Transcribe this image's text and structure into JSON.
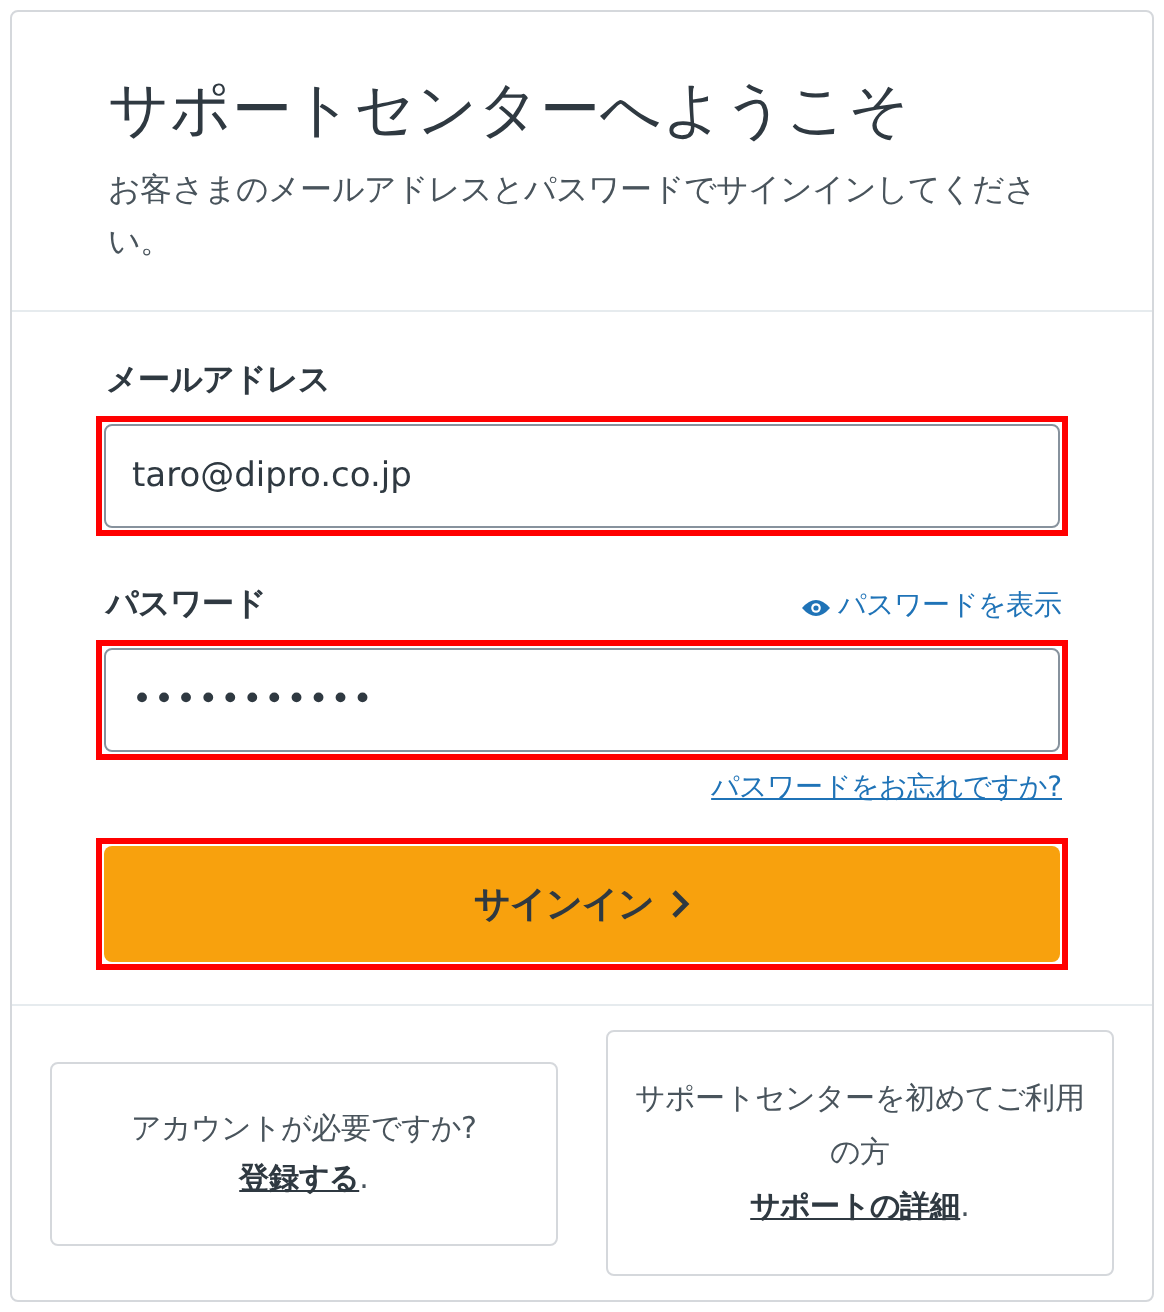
{
  "header": {
    "title": "サポートセンターへようこそ",
    "subtitle": "お客さまのメールアドレスとパスワードでサインインしてください。"
  },
  "email": {
    "label": "メールアドレス",
    "value": "taro@dipro.co.jp",
    "highlighted": true
  },
  "password": {
    "label": "パスワード",
    "show_link": "パスワードを表示",
    "value": "•••••••••••",
    "highlighted": true,
    "forgot_link": "パスワードをお忘れですか?"
  },
  "sign_in_button": {
    "label": "サインイン",
    "highlighted": true
  },
  "footer_cards": [
    {
      "prompt": "アカウントが必要ですか?",
      "link": "登録する",
      "suffix": "."
    },
    {
      "prompt": "サポートセンターを初めてご利用の方",
      "link": "サポートの詳細",
      "suffix": "."
    }
  ]
}
